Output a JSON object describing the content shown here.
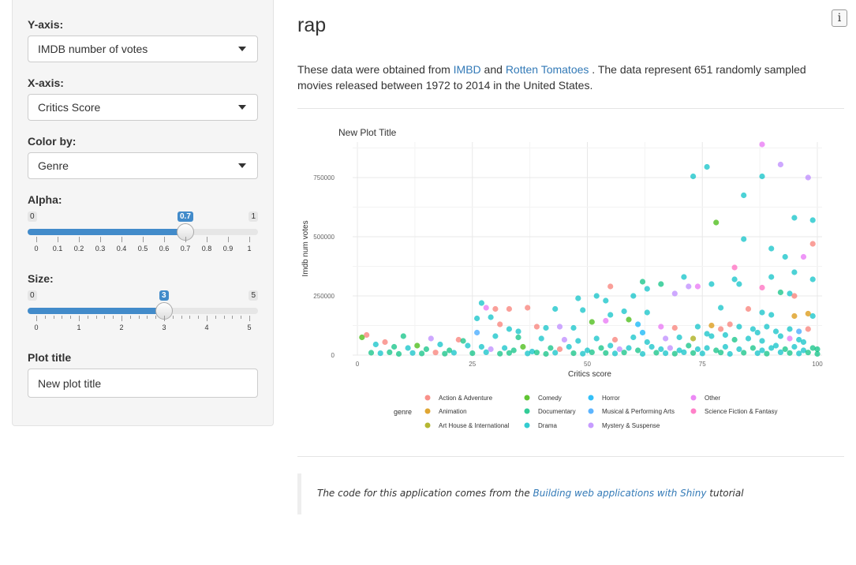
{
  "sidebar": {
    "yaxis": {
      "label": "Y-axis:",
      "value": "IMDB number of votes"
    },
    "xaxis": {
      "label": "X-axis:",
      "value": "Critics Score"
    },
    "color": {
      "label": "Color by:",
      "value": "Genre"
    },
    "alpha": {
      "label": "Alpha:",
      "min": "0",
      "max": "1",
      "value": "0.7",
      "fraction": 0.7,
      "tick_labels": [
        "0",
        "0.1",
        "0.2",
        "0.3",
        "0.4",
        "0.5",
        "0.6",
        "0.7",
        "0.8",
        "0.9",
        "1"
      ]
    },
    "size": {
      "label": "Size:",
      "min": "0",
      "max": "5",
      "value": "3",
      "fraction": 0.6,
      "tick_labels": [
        "0",
        "1",
        "2",
        "3",
        "4",
        "5"
      ]
    },
    "plot_title": {
      "label": "Plot title",
      "value": "New plot title"
    }
  },
  "main": {
    "title": "rap",
    "info_icon": "i",
    "desc": {
      "pre": "These data were obtained from ",
      "link1": "IMBD",
      "mid": " and ",
      "link2": "Rotten Tomatoes",
      "post": " . The data represent 651 randomly sampled movies released between 1972 to 2014 in the United States."
    },
    "footer": {
      "pre": "The code for this application comes from the ",
      "link": "Building web applications with Shiny",
      "post": " tutorial"
    }
  },
  "chart_data": {
    "type": "scatter",
    "title": "New Plot Title",
    "xlabel": "Critics score",
    "ylabel": "Imdb num votes",
    "xlim": [
      0,
      100
    ],
    "ylim": [
      0,
      900000
    ],
    "xticks": [
      "0",
      "25",
      "50",
      "75",
      "100"
    ],
    "yticks": [
      "0",
      "250000",
      "500000",
      "750000"
    ],
    "legend_title": "genre",
    "legend_position": "bottom",
    "genres": [
      {
        "name": "Action & Adventure",
        "color": "#F8766D"
      },
      {
        "name": "Animation",
        "color": "#D89000"
      },
      {
        "name": "Art House & International",
        "color": "#A3A500"
      },
      {
        "name": "Comedy",
        "color": "#39B600"
      },
      {
        "name": "Documentary",
        "color": "#00BF7D"
      },
      {
        "name": "Drama",
        "color": "#00BFC4"
      },
      {
        "name": "Horror",
        "color": "#00B0F6"
      },
      {
        "name": "Musical & Performing Arts",
        "color": "#35A2FF"
      },
      {
        "name": "Mystery & Suspense",
        "color": "#B983FF"
      },
      {
        "name": "Other",
        "color": "#E76BF3"
      },
      {
        "name": "Science Fiction & Fantasy",
        "color": "#FF62BC"
      }
    ],
    "points": [
      [
        88,
        890000,
        9
      ],
      [
        92,
        805000,
        8
      ],
      [
        98,
        750000,
        8
      ],
      [
        73,
        755000,
        5
      ],
      [
        76,
        795000,
        5
      ],
      [
        88,
        755000,
        5
      ],
      [
        84,
        675000,
        5
      ],
      [
        78,
        560000,
        3
      ],
      [
        95,
        580000,
        5
      ],
      [
        99,
        570000,
        5
      ],
      [
        84,
        490000,
        5
      ],
      [
        99,
        470000,
        0
      ],
      [
        90,
        450000,
        5
      ],
      [
        93,
        415000,
        5
      ],
      [
        97,
        415000,
        9
      ],
      [
        82,
        370000,
        10
      ],
      [
        95,
        350000,
        5
      ],
      [
        71,
        330000,
        5
      ],
      [
        99,
        320000,
        5
      ],
      [
        90,
        330000,
        5
      ],
      [
        62,
        310000,
        4
      ],
      [
        66,
        300000,
        4
      ],
      [
        72,
        290000,
        8
      ],
      [
        74,
        290000,
        9
      ],
      [
        77,
        300000,
        5
      ],
      [
        82,
        320000,
        5
      ],
      [
        83,
        300000,
        5
      ],
      [
        88,
        285000,
        10
      ],
      [
        92,
        265000,
        4
      ],
      [
        94,
        260000,
        5
      ],
      [
        95,
        250000,
        0
      ],
      [
        69,
        260000,
        8
      ],
      [
        63,
        280000,
        5
      ],
      [
        55,
        290000,
        0
      ],
      [
        52,
        250000,
        5
      ],
      [
        48,
        240000,
        5
      ],
      [
        60,
        250000,
        5
      ],
      [
        54,
        230000,
        5
      ],
      [
        27,
        220000,
        5
      ],
      [
        28,
        200000,
        9
      ],
      [
        30,
        195000,
        0
      ],
      [
        33,
        195000,
        0
      ],
      [
        37,
        200000,
        0
      ],
      [
        43,
        195000,
        5
      ],
      [
        49,
        190000,
        5
      ],
      [
        55,
        170000,
        5
      ],
      [
        58,
        185000,
        5
      ],
      [
        63,
        180000,
        5
      ],
      [
        79,
        200000,
        5
      ],
      [
        85,
        195000,
        0
      ],
      [
        88,
        180000,
        5
      ],
      [
        90,
        170000,
        5
      ],
      [
        95,
        165000,
        1
      ],
      [
        98,
        175000,
        1
      ],
      [
        99,
        165000,
        5
      ],
      [
        26,
        155000,
        5
      ],
      [
        29,
        160000,
        5
      ],
      [
        31,
        130000,
        0
      ],
      [
        33,
        110000,
        5
      ],
      [
        39,
        120000,
        0
      ],
      [
        41,
        115000,
        5
      ],
      [
        44,
        120000,
        8
      ],
      [
        47,
        115000,
        5
      ],
      [
        51,
        140000,
        3
      ],
      [
        54,
        145000,
        9
      ],
      [
        59,
        150000,
        3
      ],
      [
        61,
        130000,
        6
      ],
      [
        66,
        120000,
        9
      ],
      [
        69,
        115000,
        0
      ],
      [
        74,
        120000,
        5
      ],
      [
        77,
        125000,
        1
      ],
      [
        79,
        110000,
        0
      ],
      [
        81,
        130000,
        0
      ],
      [
        83,
        120000,
        5
      ],
      [
        86,
        110000,
        5
      ],
      [
        89,
        120000,
        5
      ],
      [
        91,
        100000,
        5
      ],
      [
        94,
        110000,
        5
      ],
      [
        98,
        110000,
        0
      ],
      [
        96,
        100000,
        7
      ],
      [
        10,
        80000,
        4
      ],
      [
        16,
        70000,
        8
      ],
      [
        22,
        65000,
        0
      ],
      [
        23,
        60000,
        4
      ],
      [
        30,
        80000,
        5
      ],
      [
        35,
        75000,
        4
      ],
      [
        40,
        70000,
        5
      ],
      [
        45,
        65000,
        8
      ],
      [
        48,
        60000,
        5
      ],
      [
        52,
        70000,
        5
      ],
      [
        56,
        65000,
        0
      ],
      [
        60,
        75000,
        5
      ],
      [
        63,
        55000,
        5
      ],
      [
        67,
        70000,
        8
      ],
      [
        70,
        75000,
        5
      ],
      [
        73,
        70000,
        2
      ],
      [
        77,
        80000,
        5
      ],
      [
        80,
        85000,
        5
      ],
      [
        82,
        65000,
        4
      ],
      [
        85,
        70000,
        5
      ],
      [
        88,
        60000,
        5
      ],
      [
        92,
        80000,
        5
      ],
      [
        94,
        70000,
        9
      ],
      [
        96,
        65000,
        5
      ],
      [
        97,
        55000,
        5
      ],
      [
        1,
        75000,
        3
      ],
      [
        2,
        85000,
        0
      ],
      [
        4,
        45000,
        5
      ],
      [
        6,
        55000,
        0
      ],
      [
        8,
        35000,
        4
      ],
      [
        11,
        30000,
        5
      ],
      [
        13,
        40000,
        3
      ],
      [
        15,
        25000,
        4
      ],
      [
        18,
        45000,
        5
      ],
      [
        20,
        20000,
        4
      ],
      [
        24,
        40000,
        5
      ],
      [
        27,
        35000,
        5
      ],
      [
        29,
        25000,
        8
      ],
      [
        32,
        30000,
        5
      ],
      [
        34,
        20000,
        4
      ],
      [
        36,
        35000,
        3
      ],
      [
        38,
        15000,
        5
      ],
      [
        42,
        30000,
        4
      ],
      [
        44,
        25000,
        0
      ],
      [
        46,
        35000,
        5
      ],
      [
        50,
        20000,
        5
      ],
      [
        53,
        30000,
        4
      ],
      [
        55,
        40000,
        5
      ],
      [
        57,
        25000,
        8
      ],
      [
        59,
        30000,
        5
      ],
      [
        61,
        20000,
        4
      ],
      [
        64,
        35000,
        5
      ],
      [
        66,
        25000,
        5
      ],
      [
        68,
        30000,
        8
      ],
      [
        70,
        20000,
        5
      ],
      [
        72,
        40000,
        4
      ],
      [
        74,
        25000,
        5
      ],
      [
        76,
        30000,
        5
      ],
      [
        78,
        20000,
        4
      ],
      [
        80,
        35000,
        5
      ],
      [
        83,
        25000,
        5
      ],
      [
        86,
        30000,
        4
      ],
      [
        88,
        20000,
        5
      ],
      [
        90,
        30000,
        5
      ],
      [
        93,
        25000,
        4
      ],
      [
        95,
        35000,
        5
      ],
      [
        97,
        20000,
        5
      ],
      [
        99,
        30000,
        4
      ],
      [
        100,
        25000,
        4
      ],
      [
        91,
        40000,
        5
      ],
      [
        3,
        10000,
        4
      ],
      [
        5,
        8000,
        5
      ],
      [
        7,
        12000,
        4
      ],
      [
        9,
        5000,
        4
      ],
      [
        12,
        9000,
        5
      ],
      [
        14,
        7000,
        4
      ],
      [
        17,
        11000,
        0
      ],
      [
        19,
        6000,
        4
      ],
      [
        21,
        10000,
        5
      ],
      [
        25,
        8000,
        4
      ],
      [
        28,
        12000,
        5
      ],
      [
        31,
        6000,
        4
      ],
      [
        33,
        9000,
        4
      ],
      [
        37,
        7000,
        5
      ],
      [
        39,
        11000,
        4
      ],
      [
        41,
        5000,
        4
      ],
      [
        43,
        10000,
        5
      ],
      [
        47,
        8000,
        4
      ],
      [
        49,
        6000,
        5
      ],
      [
        51,
        12000,
        4
      ],
      [
        54,
        9000,
        4
      ],
      [
        56,
        7000,
        5
      ],
      [
        58,
        11000,
        4
      ],
      [
        62,
        5000,
        5
      ],
      [
        65,
        10000,
        4
      ],
      [
        67,
        8000,
        5
      ],
      [
        69,
        6000,
        4
      ],
      [
        71,
        12000,
        5
      ],
      [
        73,
        9000,
        4
      ],
      [
        75,
        7000,
        5
      ],
      [
        79,
        11000,
        4
      ],
      [
        81,
        5000,
        5
      ],
      [
        84,
        10000,
        4
      ],
      [
        87,
        8000,
        5
      ],
      [
        89,
        6000,
        4
      ],
      [
        92,
        12000,
        5
      ],
      [
        94,
        9000,
        4
      ],
      [
        96,
        7000,
        5
      ],
      [
        98,
        11000,
        4
      ],
      [
        100,
        5000,
        4
      ],
      [
        26,
        95000,
        7
      ],
      [
        35,
        100000,
        5
      ],
      [
        62,
        95000,
        6
      ],
      [
        76,
        90000,
        5
      ],
      [
        87,
        95000,
        5
      ]
    ]
  }
}
